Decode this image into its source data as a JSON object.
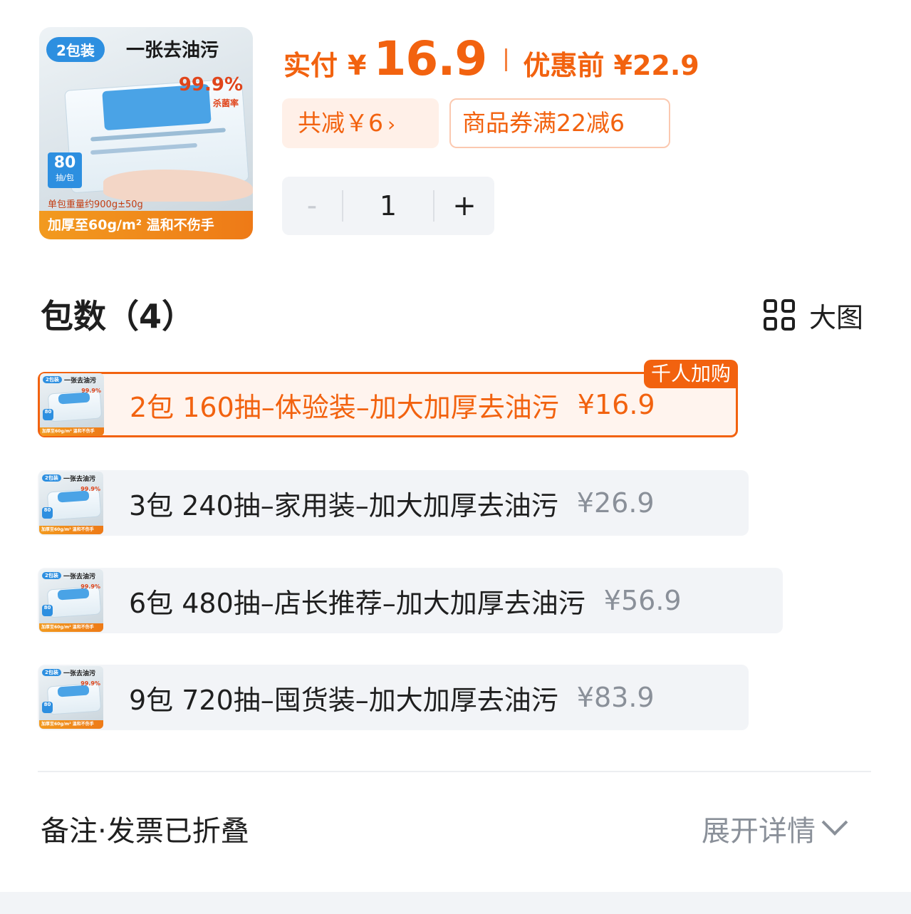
{
  "product_image": {
    "pack_badge": "2包装",
    "headline": "一张去油污",
    "percent": "99.9%",
    "percent_sub": "杀菌率",
    "count": "80",
    "count_unit": "抽/包",
    "weight": "单包重量约900g±50g",
    "bottom_text": "加厚至60g/m² 温和不伤手"
  },
  "price": {
    "paid_label": "实付",
    "currency": "¥",
    "paid_value": "16.9",
    "before_label": "优惠前 ¥22.9"
  },
  "chips": {
    "discount": "共减￥6",
    "discount_arrow": "›",
    "coupon": "商品券满22减6"
  },
  "stepper": {
    "minus": "-",
    "quantity": "1",
    "plus": "+"
  },
  "spec": {
    "title": "包数（4）",
    "big_view": "大图",
    "options": [
      {
        "text": "2包 160抽–体验装–加大加厚去油污",
        "price": "¥16.9",
        "tag": "千人加购",
        "selected": true
      },
      {
        "text": "3包 240抽–家用装–加大加厚去油污",
        "price": "¥26.9"
      },
      {
        "text": "6包 480抽–店长推荐–加大加厚去油污",
        "price": "¥56.9"
      },
      {
        "text": "9包 720抽–囤货装–加大加厚去油污",
        "price": "¥83.9"
      }
    ]
  },
  "footer": {
    "collapsed_label": "备注·发票已折叠",
    "expand_label": "展开详情"
  },
  "colors": {
    "accent": "#f2620f",
    "chip_bg": "#fff0e8",
    "option_bg": "#f2f4f7",
    "muted_text": "#8a9099"
  }
}
